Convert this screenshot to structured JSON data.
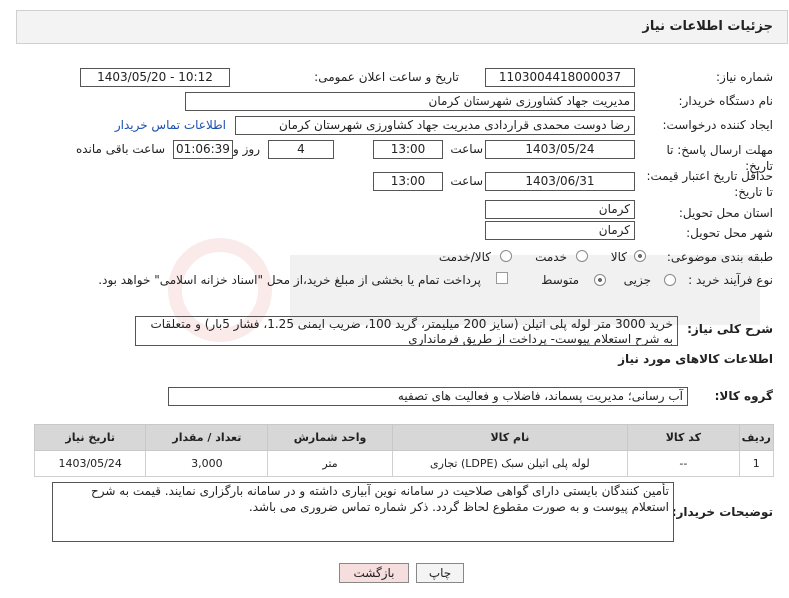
{
  "header": {
    "title": "جزئیات اطلاعات نیاز"
  },
  "fields": {
    "need_number_label": "شماره نیاز:",
    "need_number": "1103004418000037",
    "announce_label": "تاریخ و ساعت اعلان عمومی:",
    "announce_value": "1403/05/20 - 10:12",
    "buyer_label": "نام دستگاه خریدار:",
    "buyer_value": "مدیریت جهاد کشاورزی شهرستان کرمان",
    "creator_label": "ایجاد کننده درخواست:",
    "creator_value": "رضا دوست محمدی قراردادی مدیریت جهاد کشاورزی شهرستان کرمان",
    "contact_link": "اطلاعات تماس خریدار",
    "deadline_label": "مهلت ارسال پاسخ: تا تاریخ:",
    "deadline_date": "1403/05/24",
    "time_label": "ساعت",
    "deadline_time": "13:00",
    "days_value": "4",
    "days_label": "روز و",
    "remaining_value": "01:06:39",
    "remaining_label": "ساعت باقی مانده",
    "validity_label": "حداقل تاریخ اعتبار قیمت: تا تاریخ:",
    "validity_date": "1403/06/31",
    "validity_time_label": "ساعت",
    "validity_time": "13:00",
    "province_label": "استان محل تحویل:",
    "province_value": "کرمان",
    "city_label": "شهر محل تحویل:",
    "city_value": "کرمان",
    "category_label": "طبقه بندی موضوعی:",
    "category_options": [
      "کالا",
      "خدمت",
      "کالا/خدمت"
    ],
    "process_label": "نوع فرآیند خرید :",
    "process_options": [
      "جزیی",
      "متوسط"
    ],
    "payment_text": "پرداخت تمام یا بخشی از مبلغ خرید،از محل \"اسناد خزانه اسلامی\" خواهد بود.",
    "summary_label": "شرح کلی نیاز:",
    "summary_value": "خرید 3000 متر لوله پلی اتیلن (سایز 200 میلیمتر، گرید 100، ضریب ایمنی 1.25، فشار 5بار) و متعلقات به شرح استعلام پیوست- پرداخت از طریق فرمانداری",
    "goods_info_title": "اطلاعات کالاهای مورد نیاز",
    "group_label": "گروه کالا:",
    "group_value": "آب رسانی؛ مدیریت پسماند، فاضلاب و فعالیت های تصفیه",
    "buyer_notes_label": "توضیحات خریدار:",
    "buyer_notes_value": "تأمین کنندگان بایستی دارای گواهی صلاحیت در سامانه نوین آبیاری داشته و در سامانه بارگزاری نمایند. قیمت به شرح استعلام پیوست و به صورت مقطوع لحاظ گردد. ذکر شماره تماس ضروری می باشد."
  },
  "table": {
    "headers": [
      "ردیف",
      "کد کالا",
      "نام کالا",
      "واحد شمارش",
      "تعداد / مقدار",
      "تاریخ نیاز"
    ],
    "rows": [
      [
        "1",
        "--",
        "لوله پلی اتیلن سبک (LDPE) تجاری",
        "متر",
        "3,000",
        "1403/05/24"
      ]
    ]
  },
  "buttons": {
    "print": "چاپ",
    "back": "بازگشت"
  },
  "colors": {
    "link": "#1a4fb0",
    "back_button_bg": "#f7dede",
    "table_header_bg": "#d7d7d7"
  }
}
